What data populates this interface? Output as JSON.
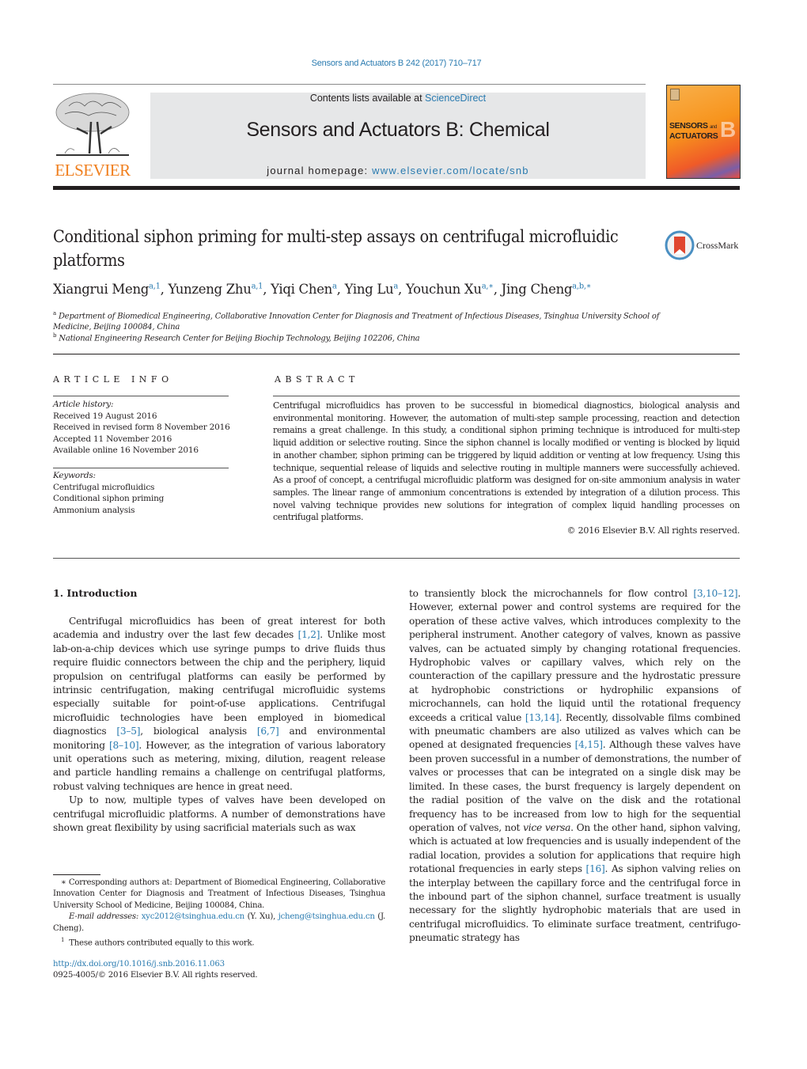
{
  "header": {
    "citation": "Sensors and Actuators B 242 (2017) 710–717",
    "contents_prefix": "Contents lists available at ",
    "contents_link": "ScienceDirect",
    "journal_title": "Sensors and Actuators B: Chemical",
    "homepage_prefix": "journal homepage: ",
    "homepage_link": "www.elsevier.com/locate/snb",
    "publisher_logo": "ELSEVIER",
    "cover": {
      "line1": "SENSORS",
      "line1_small": "and",
      "line2": "ACTUATORS",
      "letter": "B"
    }
  },
  "article": {
    "title": "Conditional siphon priming for multi-step assays on centrifugal microfluidic platforms",
    "crossmark_label": "CrossMark",
    "authors": [
      {
        "name": "Xiangrui Meng",
        "sup": "a,1",
        "sep": ", "
      },
      {
        "name": "Yunzeng Zhu",
        "sup": "a,1",
        "sep": ", "
      },
      {
        "name": "Yiqi Chen",
        "sup": "a",
        "sep": ", "
      },
      {
        "name": "Ying Lu",
        "sup": "a",
        "sep": ", "
      },
      {
        "name": "Youchun Xu",
        "sup": "a,∗",
        "sep": ", "
      },
      {
        "name": "Jing Cheng",
        "sup": "a,b,∗",
        "sep": ""
      }
    ],
    "affiliations": [
      {
        "mark": "a",
        "text": "Department of Biomedical Engineering, Collaborative Innovation Center for Diagnosis and Treatment of Infectious Diseases, Tsinghua University School of Medicine, Beijing 100084, China"
      },
      {
        "mark": "b",
        "text": "National Engineering Research Center for Beijing Biochip Technology, Beijing 102206, China"
      }
    ]
  },
  "article_info": {
    "heading": "ARTICLE INFO",
    "history_label": "Article history:",
    "history": [
      "Received 19 August 2016",
      "Received in revised form 8 November 2016",
      "Accepted 11 November 2016",
      "Available online 16 November 2016"
    ],
    "keywords_label": "Keywords:",
    "keywords": [
      "Centrifugal microfluidics",
      "Conditional siphon priming",
      "Ammonium analysis"
    ]
  },
  "abstract": {
    "heading": "ABSTRACT",
    "text": "Centrifugal microfluidics has proven to be successful in biomedical diagnostics, biological analysis and environmental monitoring. However, the automation of multi-step sample processing, reaction and detection remains a great challenge. In this study, a conditional siphon priming technique is introduced for multi-step liquid addition or selective routing. Since the siphon channel is locally modified or venting is blocked by liquid in another chamber, siphon priming can be triggered by liquid addition or venting at low frequency. Using this technique, sequential release of liquids and selective routing in multiple manners were successfully achieved. As a proof of concept, a centrifugal microfluidic platform was designed for on-site ammonium analysis in water samples. The linear range of ammonium concentrations is extended by integration of a dilution process. This novel valving technique provides new solutions for integration of complex liquid handling processes on centrifugal platforms.",
    "copyright": "© 2016 Elsevier B.V. All rights reserved."
  },
  "body": {
    "section_heading": "1.  Introduction",
    "left_paragraphs": [
      [
        {
          "t": "Centrifugal microfluidics has been of great interest for both academia and industry over the last few decades "
        },
        {
          "ref": "[1,2]"
        },
        {
          "t": ". Unlike most lab-on-a-chip devices which use syringe pumps to drive fluids thus require fluidic connectors between the chip and the periphery, liquid propulsion on centrifugal platforms can easily be performed by intrinsic centrifugation, making centrifugal microfluidic systems especially suitable for point-of-use applications. Centrifugal microfluidic technologies have been employed in biomedical diagnostics "
        },
        {
          "ref": "[3–5]"
        },
        {
          "t": ", biological analysis "
        },
        {
          "ref": "[6,7]"
        },
        {
          "t": " and environmental monitoring "
        },
        {
          "ref": "[8–10]"
        },
        {
          "t": ". However, as the integration of various laboratory unit operations such as metering, mixing, dilution, reagent release and particle handling remains a challenge on centrifugal platforms, robust valving techniques are hence in great need."
        }
      ],
      [
        {
          "t": "Up to now, multiple types of valves have been developed on centrifugal microfluidic platforms. A number of demonstrations have shown great flexibility by using sacrificial materials such as wax"
        }
      ]
    ],
    "right_paragraph": [
      {
        "t": "to transiently block the microchannels for flow control "
      },
      {
        "ref": "[3,10–12]"
      },
      {
        "t": ". However, external power and control systems are required for the operation of these active valves, which introduces complexity to the peripheral instrument. Another category of valves, known as passive valves, can be actuated simply by changing rotational frequencies. Hydrophobic valves or capillary valves, which rely on the counteraction of the capillary pressure and the hydrostatic pressure at hydrophobic constrictions or hydrophilic expansions of microchannels, can hold the liquid until the rotational frequency exceeds a critical value "
      },
      {
        "ref": "[13,14]"
      },
      {
        "t": ". Recently, dissolvable films combined with pneumatic chambers are also utilized as valves which can be opened at designated frequencies "
      },
      {
        "ref": "[4,15]"
      },
      {
        "t": ". Although these valves have been proven successful in a number of demonstrations, the number of valves or processes that can be integrated on a single disk may be limited. In these cases, the burst frequency is largely dependent on the radial position of the valve on the disk and the rotational frequency has to be increased from low to high for the sequential operation of valves, not "
      },
      {
        "i": "vice versa"
      },
      {
        "t": ". On the other hand, siphon valving, which is actuated at low frequencies and is usually independent of the radial location, provides a solution for applications that require high rotational frequencies in early steps "
      },
      {
        "ref": "[16]"
      },
      {
        "t": ". As siphon valving relies on the interplay between the capillary force and the centrifugal force in the inbound part of the siphon channel, surface treatment is usually necessary for the slightly hydrophobic materials that are used in centrifugal microfluidics. To eliminate surface treatment, centrifugo-pneumatic strategy has"
      }
    ]
  },
  "footnotes": {
    "corresponding": "∗  Corresponding authors at: Department of Biomedical Engineering, Collaborative Innovation Center for Diagnosis and Treatment of Infectious Diseases, Tsinghua University School of Medicine, Beijing 100084, China.",
    "email_label": "E-mail addresses:",
    "email1": "xyc2012@tsinghua.edu.cn",
    "email1_owner": " (Y. Xu), ",
    "email2": "jcheng@tsinghua.edu.cn",
    "email2_owner": " (J. Cheng).",
    "equal_mark": "1",
    "equal_text": "These authors contributed equally to this work.",
    "doi": "http://dx.doi.org/10.1016/j.snb.2016.11.063",
    "issn": "0925-4005/© 2016 Elsevier B.V. All rights reserved."
  },
  "colors": {
    "link": "#2a7bb0",
    "elsevier_orange": "#f07f1e",
    "banner_gray": "#e6e7e8"
  }
}
